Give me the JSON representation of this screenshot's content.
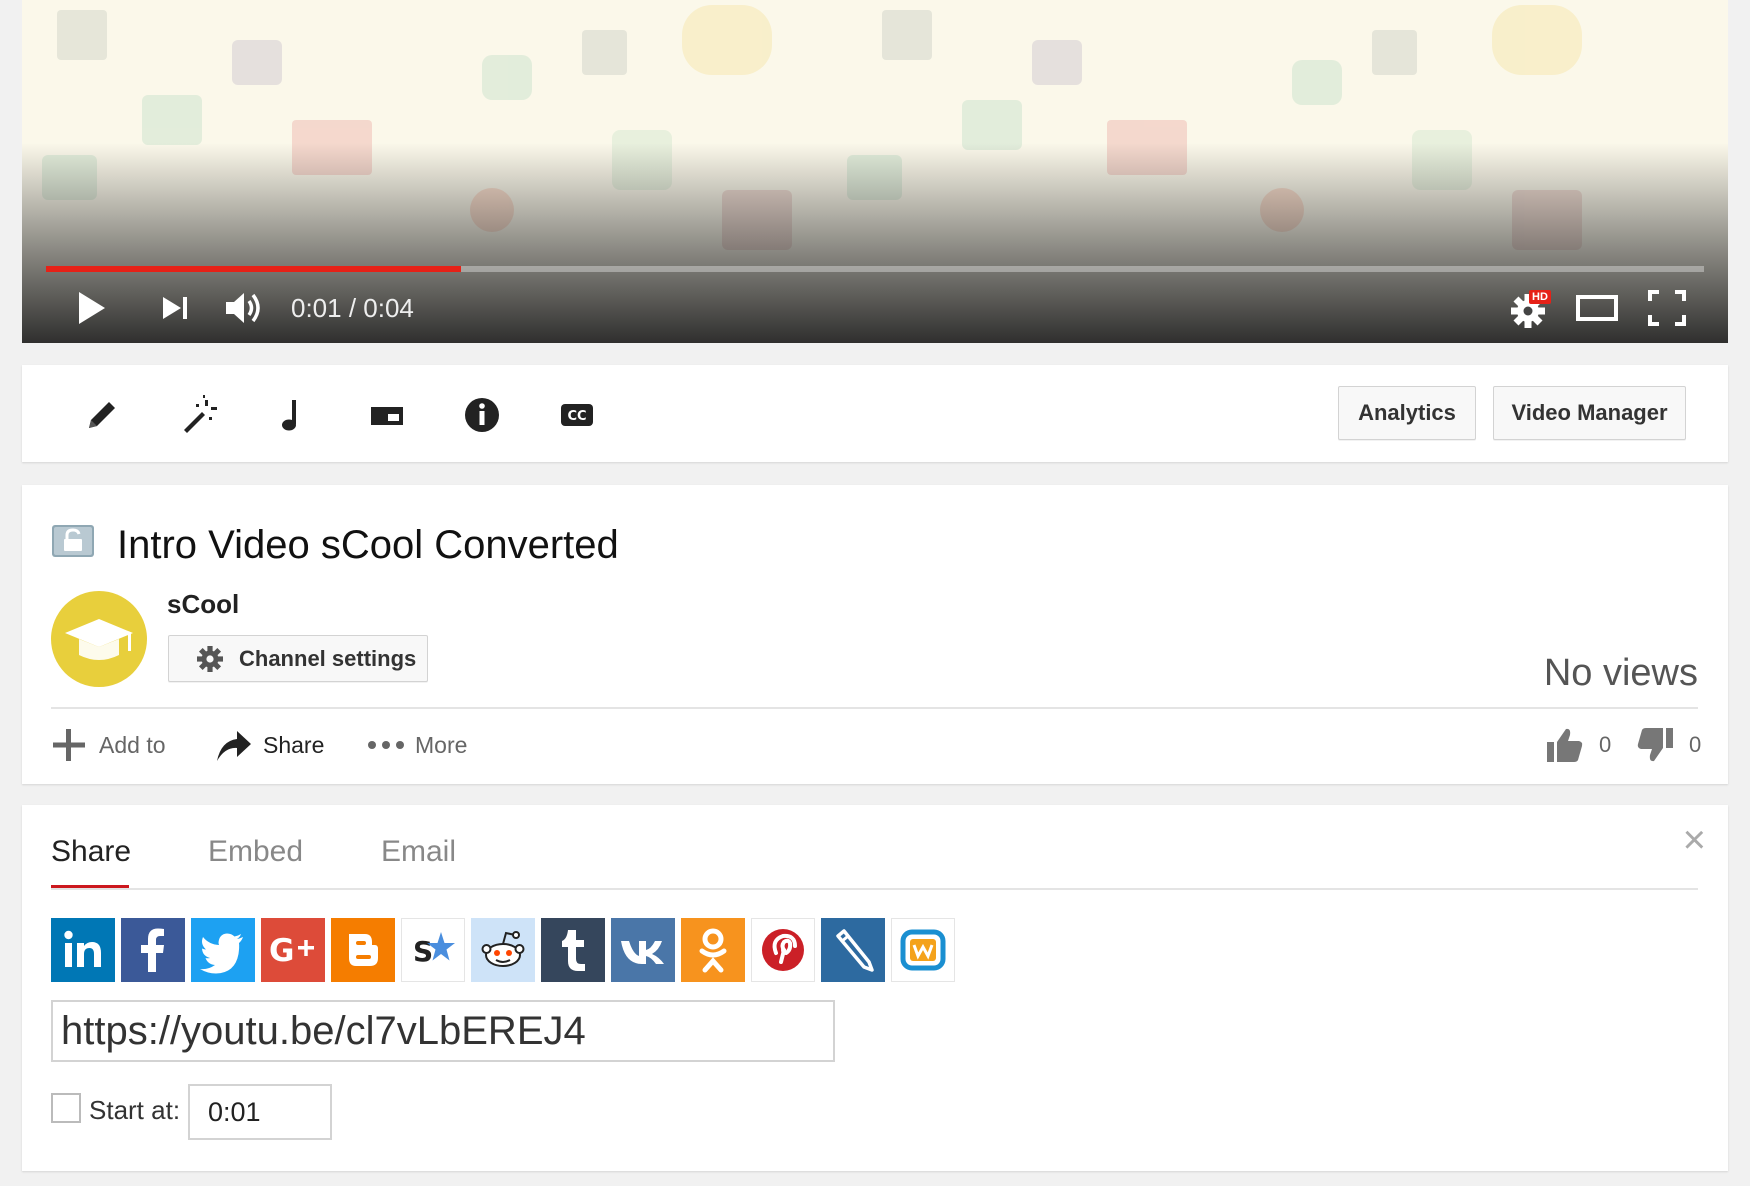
{
  "player": {
    "current_time": "0:01",
    "separator": " / ",
    "duration": "0:04",
    "progress_fraction": 0.25,
    "hd_badge": "HD",
    "controls": [
      "play-icon",
      "next-icon",
      "volume-icon",
      "settings-icon",
      "theater-mode-icon",
      "fullscreen-icon"
    ]
  },
  "toolbar": {
    "tools": [
      "pencil-icon",
      "magic-wand-icon",
      "music-note-icon",
      "end-screen-icon",
      "info-icon",
      "captions-icon"
    ],
    "cc_label": "CC",
    "analytics_label": "Analytics",
    "video_manager_label": "Video Manager"
  },
  "video": {
    "title": "Intro Video sCool Converted",
    "channel_name": "sCool",
    "channel_settings_label": "Channel settings",
    "views": "No views",
    "likes": "0",
    "dislikes": "0"
  },
  "actions": {
    "add_to": "Add to",
    "share": "Share",
    "more": "More"
  },
  "share_panel": {
    "tabs": [
      "Share",
      "Embed",
      "Email"
    ],
    "active_tab": "Share",
    "networks": [
      {
        "name": "linkedin",
        "color": "#0077b5"
      },
      {
        "name": "facebook",
        "color": "#3b5998"
      },
      {
        "name": "twitter",
        "color": "#1da1f2"
      },
      {
        "name": "google-plus",
        "color": "#dd4b39"
      },
      {
        "name": "blogger",
        "color": "#f57d00"
      },
      {
        "name": "stumbleupon",
        "color": "#ffffff"
      },
      {
        "name": "reddit",
        "color": "#cee3f8"
      },
      {
        "name": "tumblr",
        "color": "#35465c"
      },
      {
        "name": "vk",
        "color": "#4a76a8"
      },
      {
        "name": "odnoklassniki",
        "color": "#f7931e"
      },
      {
        "name": "pinterest",
        "color": "#ffffff"
      },
      {
        "name": "livejournal",
        "color": "#2d6aa0"
      },
      {
        "name": "kakao",
        "color": "#ffffff"
      }
    ],
    "url": "https://youtu.be/cl7vLbEREJ4",
    "start_at_label": "Start at:",
    "start_at_value": "0:01",
    "close_symbol": "×"
  },
  "colors": {
    "accent_red": "#e62117",
    "tab_underline": "#cc181e",
    "avatar_yellow": "#e8cf3c"
  }
}
